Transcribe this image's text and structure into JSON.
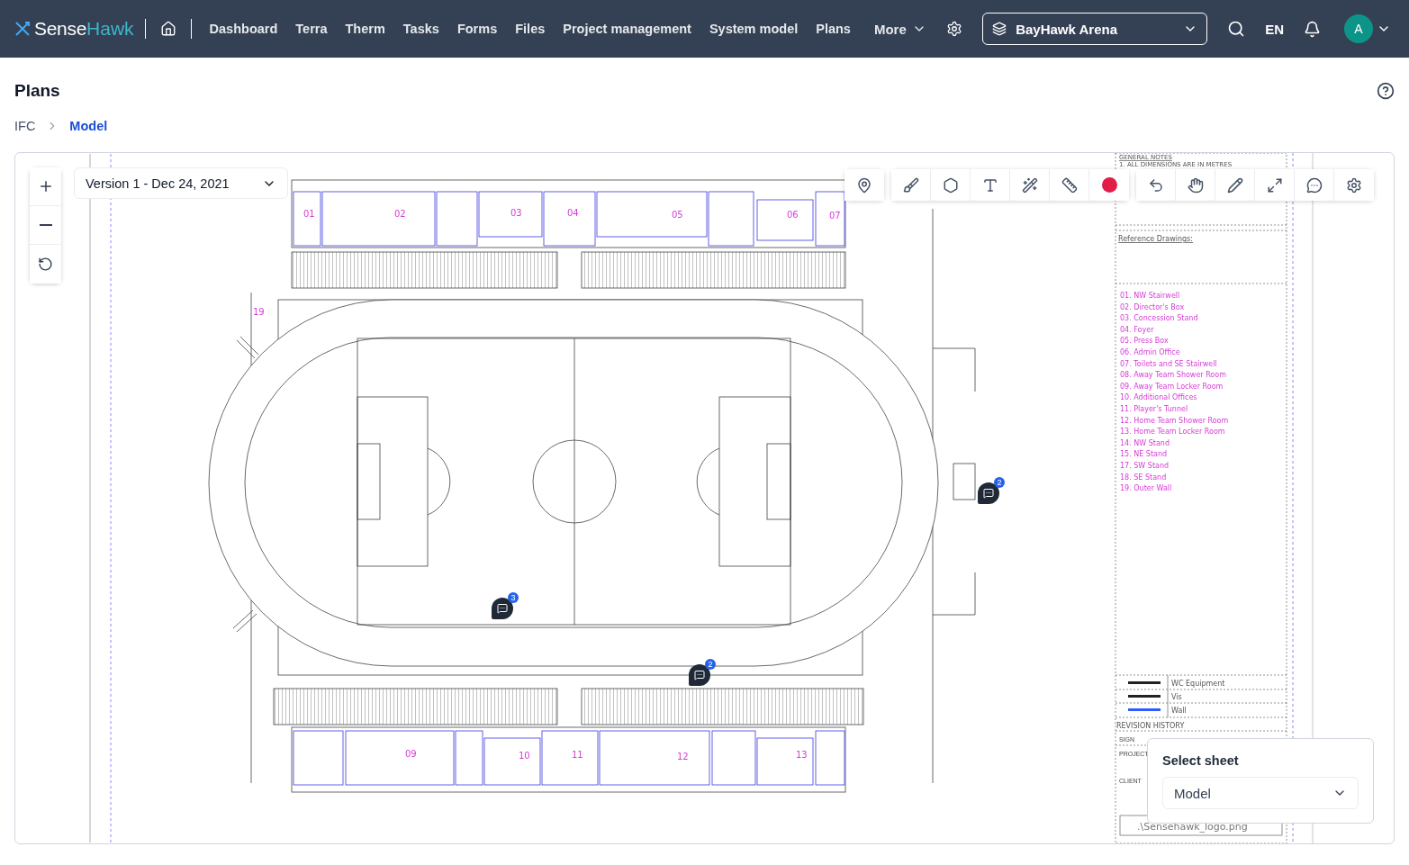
{
  "header": {
    "logo": {
      "first": "Sense",
      "second": "Hawk"
    },
    "nav": [
      "Dashboard",
      "Terra",
      "Therm",
      "Tasks",
      "Forms",
      "Files",
      "Project management",
      "System model",
      "Plans"
    ],
    "more": "More",
    "project": "BayHawk Arena",
    "language": "EN",
    "avatar": "A"
  },
  "page": {
    "title": "Plans"
  },
  "breadcrumb": [
    {
      "label": "IFC",
      "selected": false
    },
    {
      "label": "Model",
      "selected": true
    }
  ],
  "viewer": {
    "version": "Version 1 - Dec 24, 2021",
    "comments": [
      {
        "count": "3"
      },
      {
        "count": "2"
      },
      {
        "count": "2"
      }
    ],
    "sheet": {
      "label": "Select sheet",
      "value": "Model"
    }
  },
  "drawing": {
    "room_labels": [
      "01",
      "02",
      "03",
      "04",
      "05",
      "06",
      "07",
      "19",
      "09",
      "10",
      "11",
      "12",
      "13"
    ],
    "general_notes": "GENERAL NOTES",
    "note": "1. ALL DIMENSIONS ARE IN METRES",
    "reference": "Reference Drawings:",
    "legend": [
      "01. NW Stairwell",
      "02. Director's Box",
      "03. Concession Stand",
      "04. Foyer",
      "05. Press Box",
      "06. Admin Office",
      "07. Toilets and SE Stairwell",
      "08. Away Team Shower Room",
      "09. Away Team Locker Room",
      "10. Additional Offices",
      "11. Player's Tunnel",
      "12. Home Team  Shower Room",
      "13. Home Team Locker Room",
      "14. NW Stand",
      "15. NE Stand",
      "17. SW Stand",
      "18. SE Stand",
      "19. Outer Wall"
    ],
    "line_types": [
      {
        "label": "WC Equipment",
        "color": "#222222"
      },
      {
        "label": "Vis",
        "color": "#222222"
      },
      {
        "label": "Wall",
        "color": "#2f5cff"
      }
    ],
    "revision": "REVISION HISTORY",
    "fields": [
      "SIGN",
      "PROJECT",
      "CLIENT"
    ],
    "logo_file": ".\\Sensehawk_logo.png"
  }
}
